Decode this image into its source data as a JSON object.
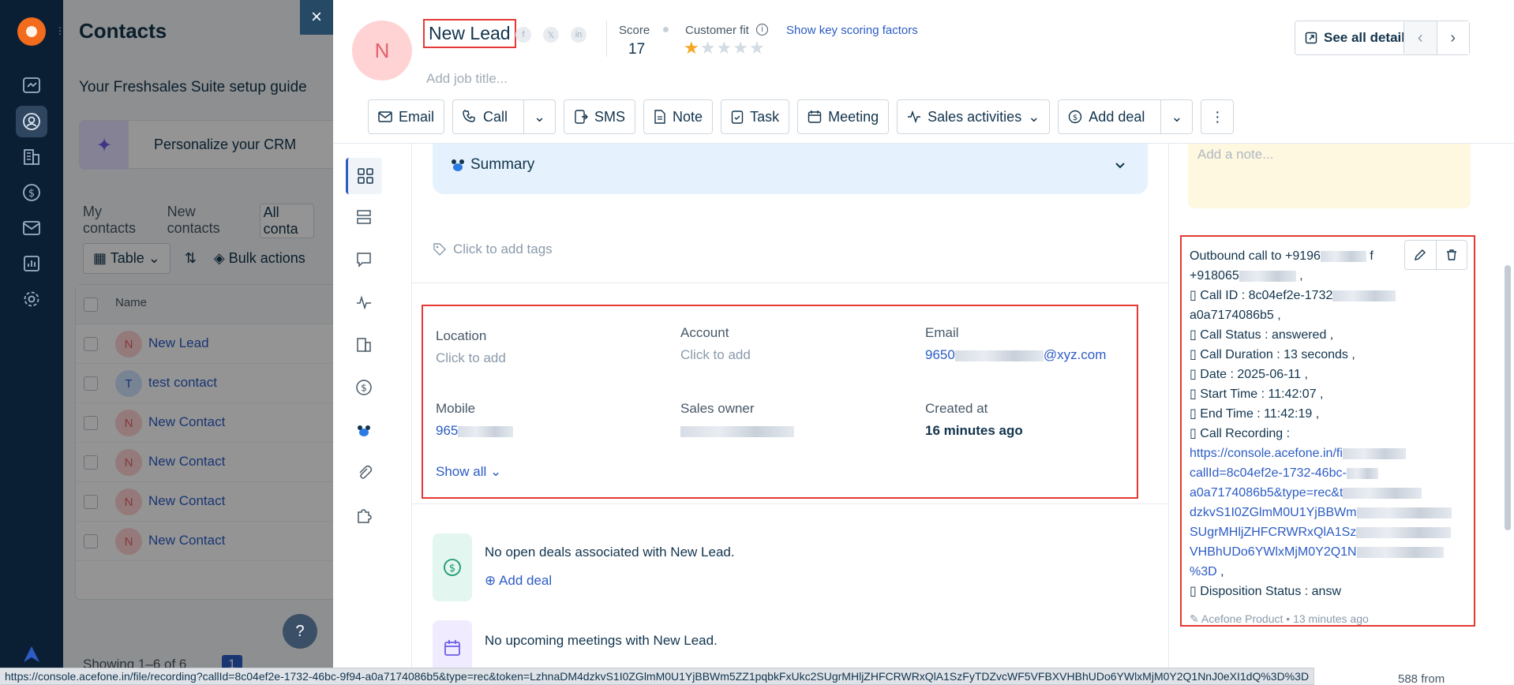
{
  "contacts": {
    "title": "Contacts",
    "setup_guide": "Your Freshsales Suite setup guide",
    "personalize": "Personalize your CRM",
    "tabs": [
      "My contacts",
      "New contacts",
      "All conta"
    ],
    "table_btn": "Table",
    "bulk_actions": "Bulk actions",
    "name_header": "Name",
    "rows": [
      {
        "initial": "N",
        "name": "New Lead"
      },
      {
        "initial": "T",
        "name": "test contact"
      },
      {
        "initial": "N",
        "name": "New Contact"
      },
      {
        "initial": "N",
        "name": "New Contact"
      },
      {
        "initial": "N",
        "name": "New Contact"
      },
      {
        "initial": "N",
        "name": "New Contact"
      }
    ],
    "showing": "Showing 1–6 of 6",
    "page": "1",
    "help": "?"
  },
  "drawer": {
    "close": "×",
    "avatar_initial": "N",
    "name": "New Lead",
    "job_title_placeholder": "Add job title...",
    "score_label": "Score",
    "score_value": "17",
    "customer_fit_label": "Customer fit",
    "customer_fit_rating": 1,
    "customer_fit_max": 5,
    "key_factors_link": "Show key scoring factors",
    "see_all_details": "See all details",
    "actions": {
      "email": "Email",
      "call": "Call",
      "sms": "SMS",
      "note": "Note",
      "task": "Task",
      "meeting": "Meeting",
      "sales_activities": "Sales activities",
      "add_deal": "Add deal"
    },
    "summary": "Summary",
    "tags_placeholder": "Click to add tags",
    "fields": {
      "location_label": "Location",
      "location_value": "Click to add",
      "account_label": "Account",
      "account_value": "Click to add",
      "email_label": "Email",
      "email_prefix": "9650",
      "email_suffix": "@xyz.com",
      "mobile_label": "Mobile",
      "mobile_prefix": "965",
      "sales_owner_label": "Sales owner",
      "created_label": "Created at",
      "created_value": "16 minutes ago",
      "show_all": "Show all"
    },
    "deals_text": "No open deals associated with New Lead.",
    "add_deal_link": "Add deal",
    "meetings_text": "No upcoming meetings with New Lead."
  },
  "right_panel": {
    "note_placeholder": "Add a note...",
    "call_lines": [
      "Outbound call to +9196",
      "+918065",
      " Call ID : 8c04ef2e-1732",
      "a0a7174086b5 ,",
      " Call Status : answered ,",
      " Call Duration : 13 seconds ,",
      " Date : 2025-06-11 ,",
      " Start Time : 11:42:07 ,",
      " End Time : 11:42:19 ,",
      " Call Recording :"
    ],
    "recording_link_lines": [
      "https://console.acefone.in/fi",
      "callId=8c04ef2e-1732-46bc-",
      "a0a7174086b5&type=rec&t",
      "dzkvS1I0ZGlmM0U1YjBBWm",
      "SUgrMHljZHFCRWRxQlA1Sz",
      "VHBhUDo6YWlxMjM0Y2Q1N",
      "%3D"
    ],
    "disposition": " Disposition Status : answ",
    "meta_author": "Acefone Product",
    "meta_time": "13 minutes ago",
    "below_text": "588 from"
  },
  "statusbar": {
    "url": "https://console.acefone.in/file/recording?callId=8c04ef2e-1732-46bc-9f94-a0a7174086b5&type=rec&token=LzhnaDM4dzkvS1I0ZGlmM0U1YjBBWm5ZZ1pqbkFxUkc2SUgrMHljZHFCRWRxQlA1SzFyTDZvcWF5VFBXVHBhUDo6YWlxMjM0Y2Q1NnJ0eXI1dQ%3D%3D"
  },
  "colors": {
    "rail_bg": "#0b1f34",
    "accent_link": "#2c5cc5",
    "highlight_red": "#e53935",
    "avatar_pink": "#ffd3d3",
    "star_orange": "#f5a623",
    "summary_bg": "#e5f2fd",
    "note_bg": "#fef8e1"
  }
}
